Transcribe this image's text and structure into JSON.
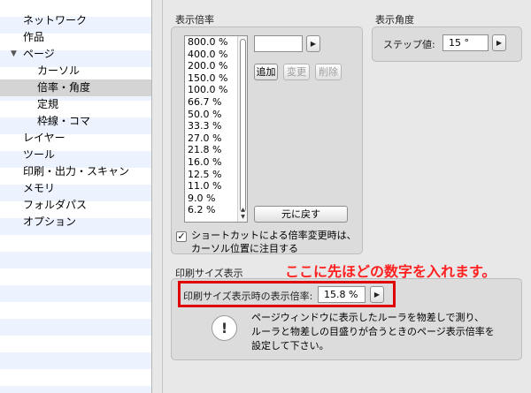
{
  "sidebar": {
    "items": [
      {
        "label": "ネットワーク"
      },
      {
        "label": "作品"
      },
      {
        "label": "ページ"
      },
      {
        "label": "カーソル"
      },
      {
        "label": "倍率・角度"
      },
      {
        "label": "定規"
      },
      {
        "label": "枠線・コマ"
      },
      {
        "label": "レイヤー"
      },
      {
        "label": "ツール"
      },
      {
        "label": "印刷・出力・スキャン"
      },
      {
        "label": "メモリ"
      },
      {
        "label": "フォルダパス"
      },
      {
        "label": "オプション"
      }
    ],
    "expander_icon": "triangle-down-icon",
    "selected": "倍率・角度"
  },
  "zoom_section": {
    "title": "表示倍率",
    "values": [
      "800.0 %",
      "400.0 %",
      "200.0 %",
      "150.0 %",
      "100.0 %",
      "66.7 %",
      "50.0 %",
      "33.3 %",
      "27.0 %",
      "21.8 %",
      "16.0 %",
      "12.5 %",
      "11.0 %",
      "9.0 %",
      "6.2 %"
    ],
    "input_value": "",
    "add_label": "追加",
    "change_label": "変更",
    "delete_label": "削除",
    "reset_label": "元に戻す",
    "checkbox_label_line1": "ショートカットによる倍率変更時は、",
    "checkbox_label_line2": "カーソル位置に注目する",
    "checkbox_checked": true
  },
  "angle_section": {
    "title": "表示角度",
    "step_label": "ステップ値:",
    "step_value": "15 °"
  },
  "print_section": {
    "title": "印刷サイズ表示",
    "field_label": "印刷サイズ表示時の表示倍率:",
    "field_value": "15.8 %",
    "info_line1": "ページウィンドウに表示したルーラを物差しで測り、",
    "info_line2": "ルーラと物差しの目盛りが合うときのページ表示倍率を",
    "info_line3": "設定して下さい。"
  },
  "annotation": {
    "text": "ここに先ほどの数字を入れます。",
    "color": "#ff2020"
  },
  "colors": {
    "highlight_frame": "#e00000",
    "stripe": "#edf3fe",
    "selected_row": "#d4d4d4"
  }
}
